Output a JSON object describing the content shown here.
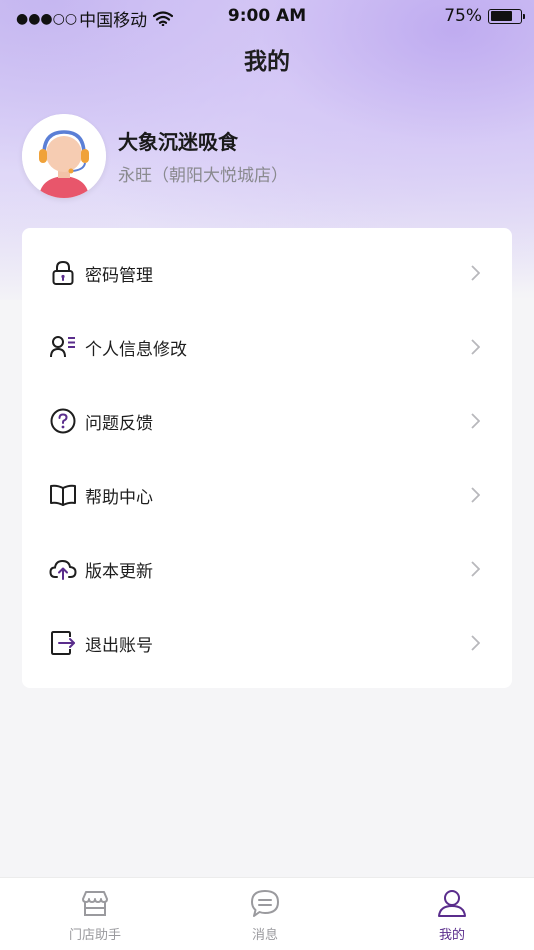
{
  "status_bar": {
    "signal": "●●●○○",
    "carrier": "中国移动",
    "time": "9:00 AM",
    "battery_text": "75%",
    "battery_level": 0.75
  },
  "header": {
    "title": "我的"
  },
  "profile": {
    "name": "大象沉迷吸食",
    "store": "永旺（朝阳大悦城店）"
  },
  "menu": {
    "items": [
      {
        "label": "密码管理",
        "icon": "lock-icon"
      },
      {
        "label": "个人信息修改",
        "icon": "user-info-icon"
      },
      {
        "label": "问题反馈",
        "icon": "question-circle-icon"
      },
      {
        "label": "帮助中心",
        "icon": "book-icon"
      },
      {
        "label": "版本更新",
        "icon": "cloud-upload-icon"
      },
      {
        "label": "退出账号",
        "icon": "logout-icon"
      }
    ]
  },
  "tabbar": {
    "tabs": [
      {
        "label": "门店助手",
        "icon": "store-icon",
        "active": false
      },
      {
        "label": "消息",
        "icon": "message-icon",
        "active": false
      },
      {
        "label": "我的",
        "icon": "profile-icon",
        "active": true
      }
    ]
  },
  "colors": {
    "accent": "#5a2d8c",
    "hero_gradient": "#cfc3f3",
    "inactive_tab": "#9a9a9e"
  }
}
